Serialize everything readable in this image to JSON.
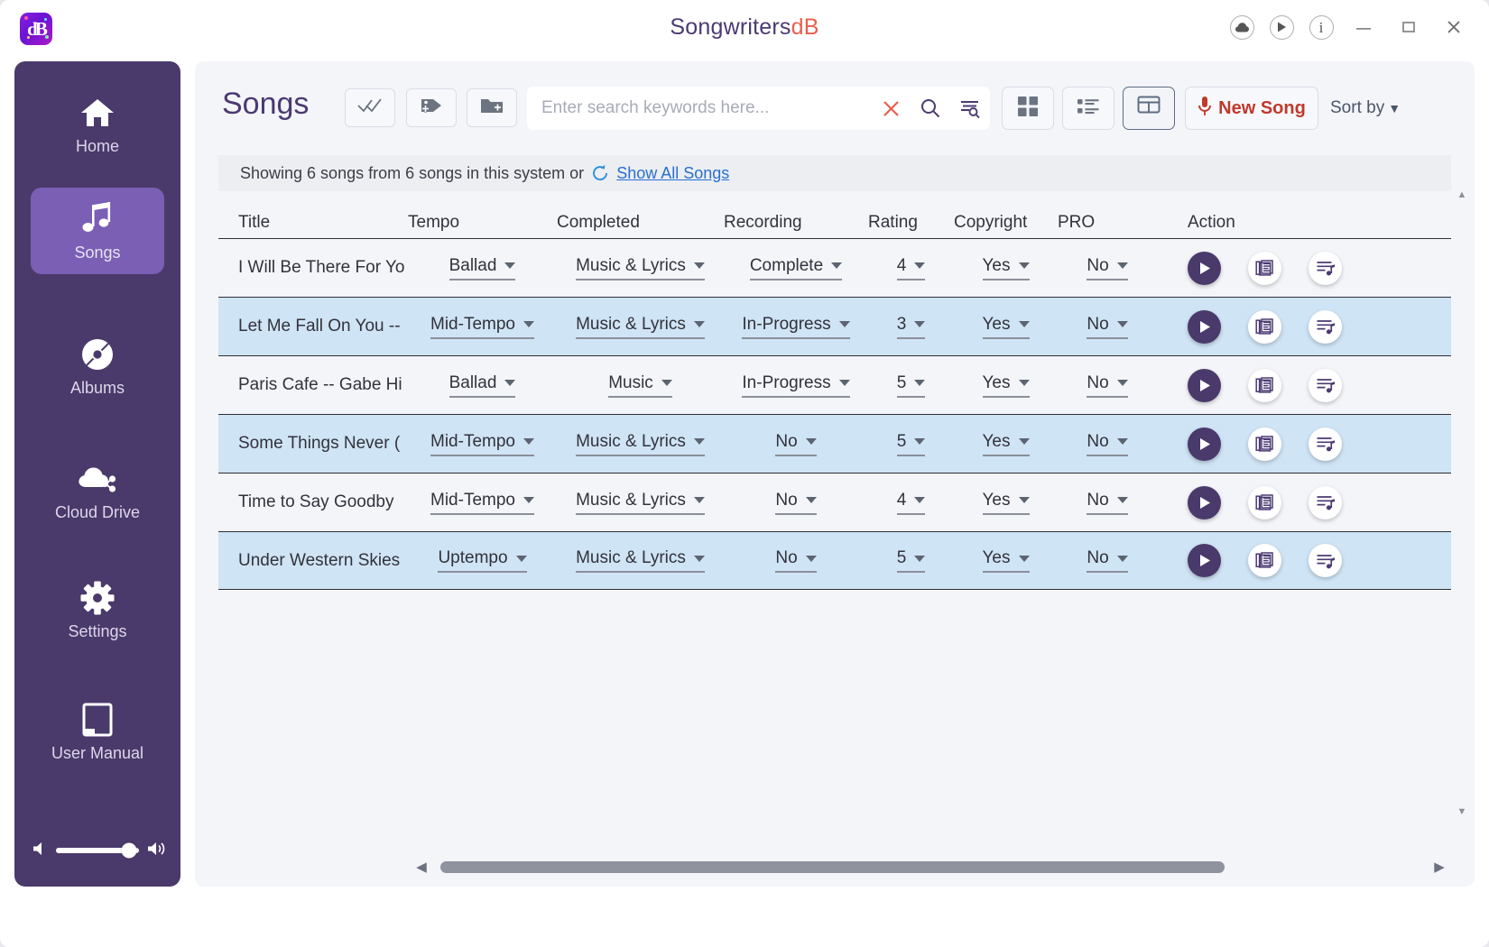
{
  "window": {
    "title_part1": "Songwriters",
    "title_part2": "dB",
    "accent_purple": "#4a3a6b",
    "accent_red": "#c0392b",
    "controls": {
      "cloud": "cloud-icon",
      "play": "play-icon",
      "info": "info-icon",
      "minimize": "minimize-icon",
      "maximize": "maximize-icon",
      "close": "close-icon"
    }
  },
  "sidebar": {
    "items": [
      {
        "label": "Home",
        "icon": "home-icon",
        "active": false
      },
      {
        "label": "Songs",
        "icon": "music-note-icon",
        "active": true
      },
      {
        "label": "Albums",
        "icon": "disc-icon",
        "active": false
      },
      {
        "label": "Cloud Drive",
        "icon": "cloud-share-icon",
        "active": false
      },
      {
        "label": "Settings",
        "icon": "gear-icon",
        "active": false
      },
      {
        "label": "User Manual",
        "icon": "book-icon",
        "active": false
      }
    ],
    "volume": {
      "value": 88,
      "mute_icon": "speaker-mute-icon",
      "loud_icon": "speaker-loud-icon"
    }
  },
  "toolbar": {
    "page_title": "Songs",
    "buttons": [
      {
        "name": "select-all-button",
        "icon": "double-check-icon"
      },
      {
        "name": "add-tag-button",
        "icon": "tag-plus-icon"
      },
      {
        "name": "new-folder-button",
        "icon": "folder-plus-icon"
      }
    ],
    "search": {
      "placeholder": "Enter search keywords here...",
      "value": "",
      "clear_icon": "clear-x-icon",
      "search_icon": "search-icon",
      "advanced_icon": "advanced-search-icon"
    },
    "views": [
      {
        "name": "grid-view-button",
        "icon": "grid-icon",
        "selected": false
      },
      {
        "name": "list-view-button",
        "icon": "list-icon",
        "selected": false
      },
      {
        "name": "table-view-button",
        "icon": "table-icon",
        "selected": true
      }
    ],
    "new_song_label": "New Song",
    "new_song_icon": "microphone-icon",
    "sort_by_label": "Sort by",
    "sort_by_caret": "▼"
  },
  "status": {
    "text": "Showing 6 songs from 6 songs in this system  or",
    "refresh_icon": "refresh-icon",
    "link": "Show All Songs"
  },
  "table": {
    "headers": [
      "Title",
      "Tempo",
      "Completed",
      "Recording",
      "Rating",
      "Copyright",
      "PRO",
      "Action"
    ],
    "rows": [
      {
        "title": "I Will Be There For Yo",
        "tempo": "Ballad",
        "completed": "Music & Lyrics",
        "recording": "Complete",
        "rating": "4",
        "copyright": "Yes",
        "pro": "No",
        "alt": false
      },
      {
        "title": "Let Me Fall On You --",
        "tempo": "Mid-Tempo",
        "completed": "Music & Lyrics",
        "recording": "In-Progress",
        "rating": "3",
        "copyright": "Yes",
        "pro": "No",
        "alt": true
      },
      {
        "title": "Paris Cafe -- Gabe Hi",
        "tempo": "Ballad",
        "completed": "Music",
        "recording": "In-Progress",
        "rating": "5",
        "copyright": "Yes",
        "pro": "No",
        "alt": false
      },
      {
        "title": "Some Things Never (",
        "tempo": "Mid-Tempo",
        "completed": "Music & Lyrics",
        "recording": "No",
        "rating": "5",
        "copyright": "Yes",
        "pro": "No",
        "alt": true
      },
      {
        "title": "Time to Say Goodby",
        "tempo": "Mid-Tempo",
        "completed": "Music & Lyrics",
        "recording": "No",
        "rating": "4",
        "copyright": "Yes",
        "pro": "No",
        "alt": false
      },
      {
        "title": "Under Western Skies",
        "tempo": "Uptempo",
        "completed": "Music & Lyrics",
        "recording": "No",
        "rating": "5",
        "copyright": "Yes",
        "pro": "No",
        "alt": true
      }
    ],
    "action_icons": [
      "play-circle-icon",
      "lyrics-document-icon",
      "playlist-icon"
    ]
  },
  "scrollbars": {
    "vertical_up": "▲",
    "vertical_down": "▼",
    "horizontal_left": "◀",
    "horizontal_right": "▶",
    "h_thumb_percent": 80
  }
}
